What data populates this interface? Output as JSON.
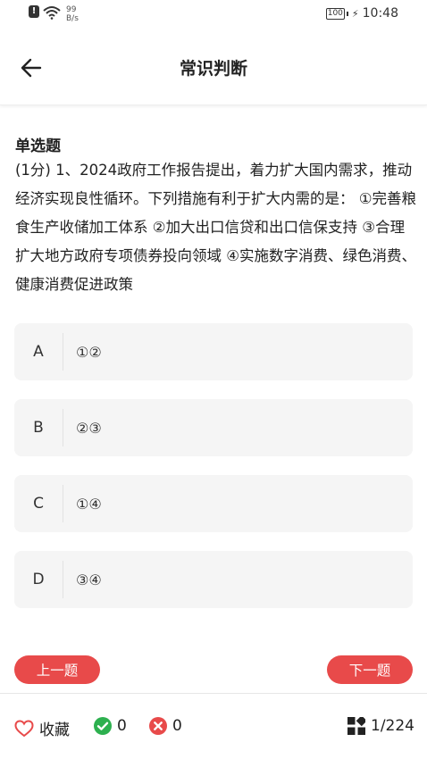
{
  "status_bar": {
    "speed_value": "99",
    "speed_unit": "B/s",
    "battery": "100",
    "time": "10:48"
  },
  "header": {
    "title": "常识判断",
    "back_icon": "arrow-left-icon"
  },
  "question": {
    "type": "单选题",
    "text": "(1分) 1、2024政府工作报告提出，着力扩大国内需求，推动经济实现良性循环。下列措施有利于扩大内需的是： ①完善粮食生产收储加工体系 ②加大出口信贷和出口信保支持 ③合理扩大地方政府专项债券投向领域 ④实施数字消费、绿色消费、健康消费促进政策"
  },
  "options": [
    {
      "letter": "A",
      "text": "①②"
    },
    {
      "letter": "B",
      "text": "②③"
    },
    {
      "letter": "C",
      "text": "①④"
    },
    {
      "letter": "D",
      "text": "③④"
    }
  ],
  "nav": {
    "prev_label": "上一题",
    "next_label": "下一题"
  },
  "bottom_bar": {
    "favorite_label": "收藏",
    "correct_count": "0",
    "wrong_count": "0",
    "progress": "1/224"
  },
  "colors": {
    "accent": "#e84a4a",
    "correct": "#2db04f",
    "wrong": "#e84a4a"
  }
}
